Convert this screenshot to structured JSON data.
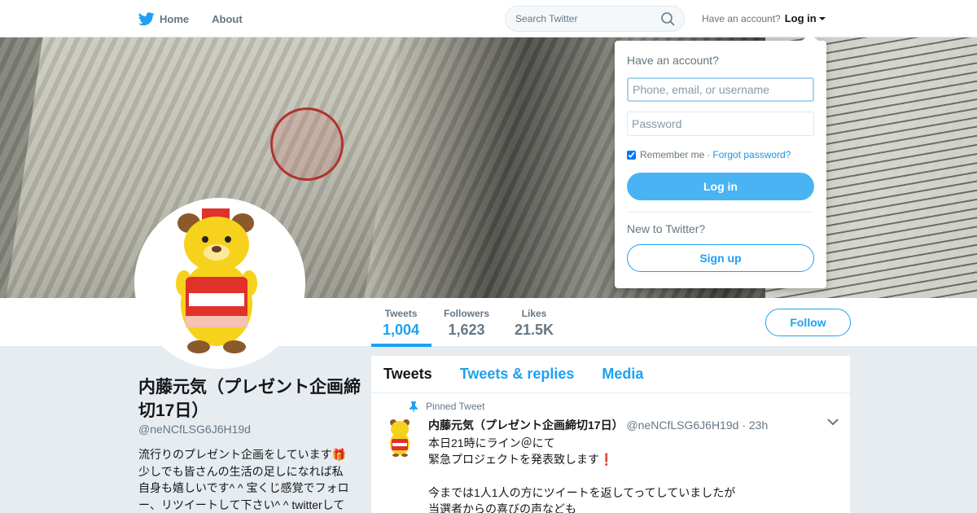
{
  "nav": {
    "home_label": "Home",
    "about_label": "About",
    "search_placeholder": "Search Twitter",
    "account_prompt": "Have an account?",
    "login_label": "Log in"
  },
  "profile": {
    "name": "内藤元気（プレゼント企画締切17日）",
    "handle": "@neNCfLSG6J6H19d",
    "bio": "流行りのプレゼント企画をしています🎁少しでも皆さんの生活の足しになれば私自身も嬉しいです^ ^ 宝くじ感覚でフォロー、リツイートして下さい^ ^ twitterして"
  },
  "stats": [
    {
      "label": "Tweets",
      "value": "1,004"
    },
    {
      "label": "Followers",
      "value": "1,623"
    },
    {
      "label": "Likes",
      "value": "21.5K"
    }
  ],
  "follow_label": "Follow",
  "timeline": {
    "tabs": [
      "Tweets",
      "Tweets & replies",
      "Media"
    ],
    "pinned_label": "Pinned Tweet",
    "tweet": {
      "author": "内藤元気（プレゼント企画締切17日）",
      "handle": "@neNCfLSG6J6H19d",
      "separator": "·",
      "time": "23h",
      "text": "本日21時にライン＠にて\n緊急プロジェクトを発表致します❗\n\n今までは1人1人の方にツイートを返してってしていましたが\n当選者からの喜びの声なども"
    }
  },
  "login_dropdown": {
    "title": "Have an account?",
    "username_placeholder": "Phone, email, or username",
    "password_placeholder": "Password",
    "remember_label": "Remember me",
    "separator": "·",
    "forgot_label": "Forgot password?",
    "login_button": "Log in",
    "new_prompt": "New to Twitter?",
    "signup_button": "Sign up"
  },
  "colors": {
    "accent": "#1da1f2",
    "login_button_bg": "#4ab3f4",
    "page_bg": "#e6ecf0"
  }
}
